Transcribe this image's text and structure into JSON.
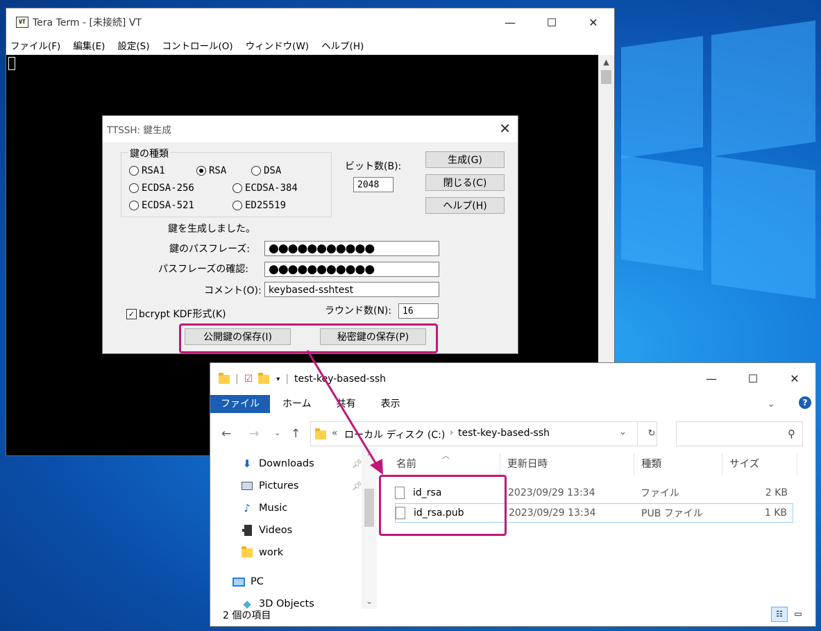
{
  "teraterm": {
    "logo": "VT",
    "title": "Tera Term - [未接続] VT",
    "menu": [
      "ファイル(F)",
      "編集(E)",
      "設定(S)",
      "コントロール(O)",
      "ウィンドウ(W)",
      "ヘルプ(H)"
    ]
  },
  "dialog": {
    "title": "TTSSH: 鍵生成",
    "group_label": "鍵の種類",
    "key_types": [
      "RSA1",
      "RSA",
      "DSA",
      "ECDSA-256",
      "ECDSA-384",
      "ECDSA-521",
      "ED25519"
    ],
    "selected_key_type": "RSA",
    "bits_label": "ビット数(B):",
    "bits_value": "2048",
    "buttons": {
      "generate": "生成(G)",
      "close": "閉じる(C)",
      "help": "ヘルプ(H)"
    },
    "status_text": "鍵を生成しました。",
    "passphrase_label": "鍵のパスフレーズ:",
    "passphrase_value": "●●●●●●●●●●●",
    "confirm_label": "パスフレーズの確認:",
    "confirm_value": "●●●●●●●●●●●",
    "comment_label": "コメント(O):",
    "comment_value": "keybased-sshtest",
    "bcrypt_label": "bcrypt KDF形式(K)",
    "bcrypt_checked": true,
    "rounds_label": "ラウンド数(N):",
    "rounds_value": "16",
    "save_public": "公開鍵の保存(I)",
    "save_private": "秘密鍵の保存(P)"
  },
  "explorer": {
    "title": "test-key-based-ssh",
    "tabs": [
      "ファイル",
      "ホーム",
      "共有",
      "表示"
    ],
    "breadcrumb": [
      "ローカル ディスク (C:)",
      "test-key-based-ssh"
    ],
    "breadcrumb_prefix": "«",
    "nav_items": [
      {
        "label": "Downloads",
        "icon": "download-arrow-icon",
        "pinned": true
      },
      {
        "label": "Pictures",
        "icon": "picture-icon",
        "pinned": true
      },
      {
        "label": "Music",
        "icon": "music-note-icon",
        "pinned": false
      },
      {
        "label": "Videos",
        "icon": "film-icon",
        "pinned": false
      },
      {
        "label": "work",
        "icon": "folder-icon",
        "pinned": false
      },
      {
        "label": "PC",
        "icon": "computer-icon",
        "pinned": false
      },
      {
        "label": "3D Objects",
        "icon": "3d-objects-icon",
        "pinned": false
      }
    ],
    "columns": [
      "名前",
      "更新日時",
      "種類",
      "サイズ"
    ],
    "files": [
      {
        "name": "id_rsa",
        "modified": "2023/09/29 13:34",
        "type": "ファイル",
        "size": "2 KB"
      },
      {
        "name": "id_rsa.pub",
        "modified": "2023/09/29 13:34",
        "type": "PUB ファイル",
        "size": "1 KB"
      }
    ],
    "status": "2 個の項目"
  },
  "colors": {
    "highlight": "#c0187a",
    "ribbon_active": "#1a5fb4"
  }
}
